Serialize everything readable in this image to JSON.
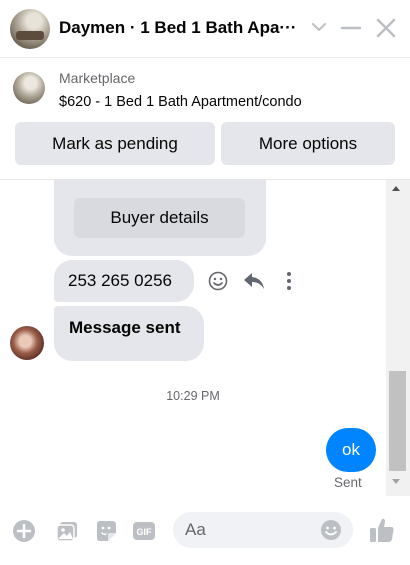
{
  "header": {
    "title": "Daymen · 1 Bed 1 Bath Apa···",
    "icons": [
      "chevron-down-icon",
      "minimize-icon",
      "close-icon"
    ]
  },
  "listing": {
    "source": "Marketplace",
    "title": "$620 - 1 Bed 1 Bath Apartment/condo",
    "mark_pending_label": "Mark as pending",
    "more_options_label": "More options"
  },
  "chat": {
    "buyer_details_label": "Buyer details",
    "phone_message": "253 265 0256",
    "sent_message": "Message sent",
    "timestamp": "10:29 PM",
    "my_message": "ok",
    "status": "Sent"
  },
  "composer": {
    "placeholder": "Aa",
    "icons": [
      "plus-icon",
      "photo-icon",
      "sticker-icon",
      "gif-icon",
      "emoji-icon",
      "like-icon"
    ]
  },
  "colors": {
    "accent": "#0084ff",
    "bubble_gray": "#e4e6eb",
    "icon_gray": "#bcc0c4"
  }
}
